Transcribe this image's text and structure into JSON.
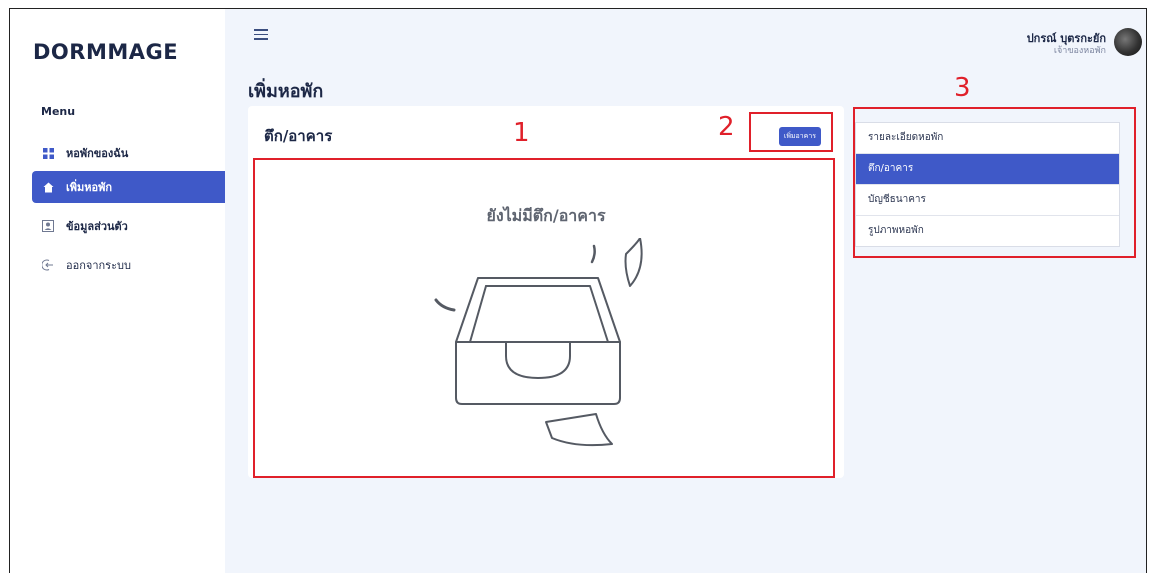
{
  "brand": "DORMMAGE",
  "sidebar": {
    "menu_title": "Menu",
    "items": [
      {
        "label": "หอพักของฉัน",
        "icon": "grid-icon",
        "active": false
      },
      {
        "label": "เพิ่มหอพัก",
        "icon": "home-icon",
        "active": true
      },
      {
        "label": "ข้อมูลส่วนตัว",
        "icon": "profile-icon",
        "active": false
      },
      {
        "label": "ออกจากระบบ",
        "icon": "logout-icon",
        "active": false
      }
    ]
  },
  "header": {
    "user_name": "ปกรณ์ บุตรกะยัก",
    "user_role": "เจ้าของหอพัก"
  },
  "page": {
    "title": "เพิ่มหอพัก",
    "card_title": "ตึก/อาคาร",
    "add_button": "เพิ่มอาคาร",
    "empty_message": "ยังไม่มีตึก/อาคาร"
  },
  "side_menu": {
    "items": [
      {
        "label": "รายละเอียดหอพัก",
        "active": false
      },
      {
        "label": "ตึก/อาคาร",
        "active": true
      },
      {
        "label": "บัญชีธนาคาร",
        "active": false
      },
      {
        "label": "รูปภาพหอพัก",
        "active": false
      }
    ]
  },
  "annotations": {
    "one": "1",
    "two": "2",
    "three": "3"
  },
  "colors": {
    "accent": "#3f59c8",
    "background": "#f1f5fc",
    "annotation": "#e0202a"
  }
}
